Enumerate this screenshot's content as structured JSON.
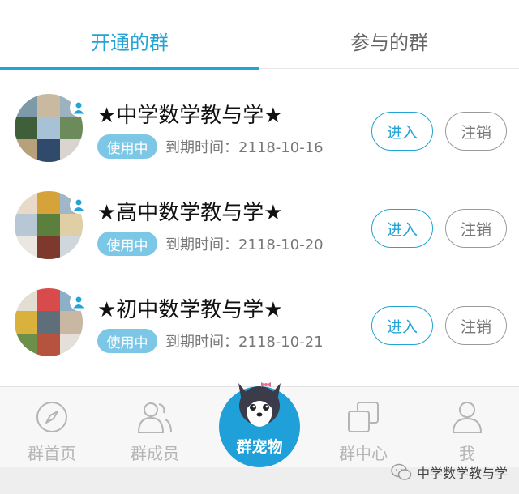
{
  "tabs": [
    {
      "label": "开通的群",
      "active": true
    },
    {
      "label": "参与的群",
      "active": false
    }
  ],
  "groups": [
    {
      "name": "★中学数学教与学★",
      "status": "使用中",
      "expire": "到期时间：2118-10-16",
      "enter_label": "进入",
      "cancel_label": "注销"
    },
    {
      "name": "★高中数学教与学★",
      "status": "使用中",
      "expire": "到期时间：2118-10-20",
      "enter_label": "进入",
      "cancel_label": "注销"
    },
    {
      "name": "★初中数学教与学★",
      "status": "使用中",
      "expire": "到期时间：2118-10-21",
      "enter_label": "进入",
      "cancel_label": "注销"
    }
  ],
  "nav": [
    {
      "label": "群首页",
      "icon": "compass-icon"
    },
    {
      "label": "群成员",
      "icon": "members-icon"
    },
    {
      "label": "群宠物",
      "icon": "husky-pet-icon"
    },
    {
      "label": "群中心",
      "icon": "overlap-squares-icon"
    },
    {
      "label": "我",
      "icon": "person-icon"
    }
  ],
  "watermark": "中学数学教与学",
  "colors": {
    "accent": "#23a3d6",
    "status_pill": "#7cc6e6",
    "inactive_nav": "#b5b5b5"
  }
}
